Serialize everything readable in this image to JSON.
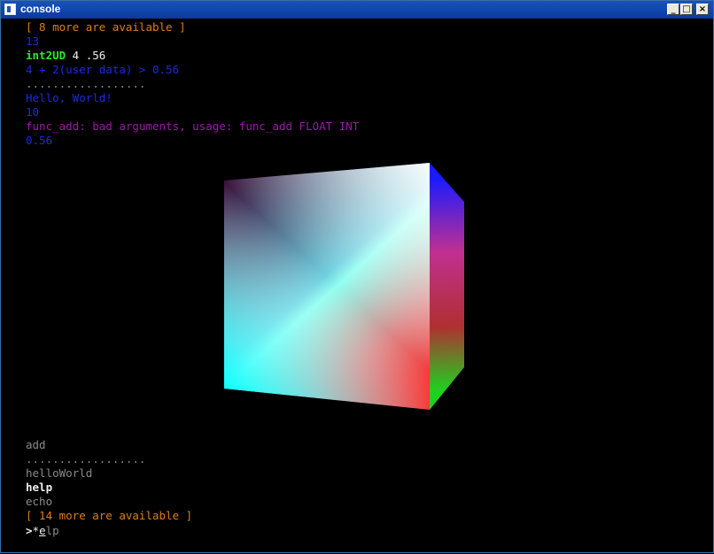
{
  "window": {
    "title": "console"
  },
  "window_controls": {
    "minimize": "_",
    "maximize": "□",
    "close": "×"
  },
  "console": {
    "top_lines": [
      {
        "text": "[ 8 more are available ]",
        "color": "orange"
      },
      {
        "text": "13",
        "color": "blue"
      },
      {
        "cmd": "int2UD",
        "args": " 4 .56"
      },
      {
        "text": "4 + 2(user data) > 0.56",
        "color": "blue"
      },
      {
        "text": "..................",
        "color": "grey"
      },
      {
        "text": "Hello, World!",
        "color": "blue"
      },
      {
        "text": "10",
        "color": "blue"
      },
      {
        "text": "func_add: bad arguments, usage: func_add FLOAT INT",
        "color": "purple"
      },
      {
        "text": "0.56",
        "color": "blue"
      }
    ],
    "bottom_lines": [
      {
        "text": "add",
        "color": "grey"
      },
      {
        "text": "..................",
        "color": "grey"
      },
      {
        "text": "helloWorld",
        "color": "grey"
      },
      {
        "text": "help",
        "color": "white"
      },
      {
        "text": "echo",
        "color": "grey"
      },
      {
        "text": "[ 14 more are available ]",
        "color": "orange"
      }
    ],
    "prompt": {
      "symbol": ">",
      "typed": "*",
      "cursor_char": "e",
      "completion": "lp"
    }
  }
}
